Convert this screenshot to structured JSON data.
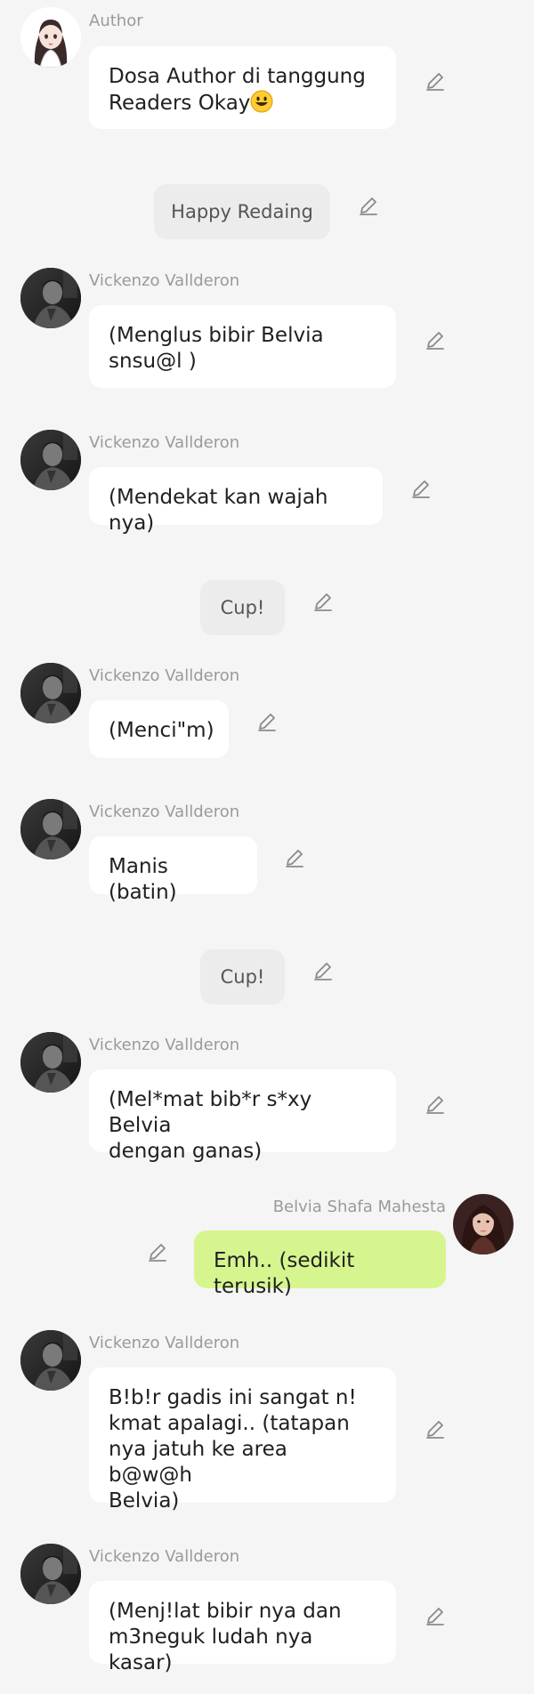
{
  "messages": [
    {
      "type": "left",
      "author": "Author",
      "text": "Dosa Author di tanggung\nReaders Okay",
      "emoji": "grinning-face"
    },
    {
      "type": "narration",
      "text": "Happy Redaing"
    },
    {
      "type": "left",
      "author": "Vickenzo Vallderon",
      "text": "(Menglus bibir Belvia\nsnsu@l )"
    },
    {
      "type": "left",
      "author": "Vickenzo Vallderon",
      "text": "(Mendekat kan wajah nya)"
    },
    {
      "type": "narration",
      "text": "Cup!"
    },
    {
      "type": "left",
      "author": "Vickenzo Vallderon",
      "text": "(Menci\"m)"
    },
    {
      "type": "left",
      "author": "Vickenzo Vallderon",
      "text": "Manis (batin)"
    },
    {
      "type": "narration",
      "text": "Cup!"
    },
    {
      "type": "left",
      "author": "Vickenzo Vallderon",
      "text": "(Mel*mat bib*r s*xy Belvia\ndengan ganas)"
    },
    {
      "type": "right",
      "author": "Belvia Shafa Mahesta",
      "text": "Emh.. (sedikit terusik)"
    },
    {
      "type": "left",
      "author": "Vickenzo Vallderon",
      "text": "B!b!r gadis ini sangat n!\nkmat apalagi.. (tatapan\nnya jatuh ke area b@w@h\nBelvia)"
    },
    {
      "type": "left",
      "author": "Vickenzo Vallderon",
      "text": "(Menj!lat bibir nya dan\nm3neguk ludah nya kasar)"
    }
  ],
  "icons": {
    "edit": "pencil-icon",
    "author_avatar": "anime-girl-avatar",
    "vickenzo_avatar": "dark-photo-avatar",
    "belvia_avatar": "girl-photo-avatar"
  },
  "colors": {
    "background": "#f5f5f5",
    "bubble": "#ffffff",
    "own_bubble": "#d7f58f",
    "narration_bubble": "#ececec",
    "name_text": "#9a9a9a"
  }
}
